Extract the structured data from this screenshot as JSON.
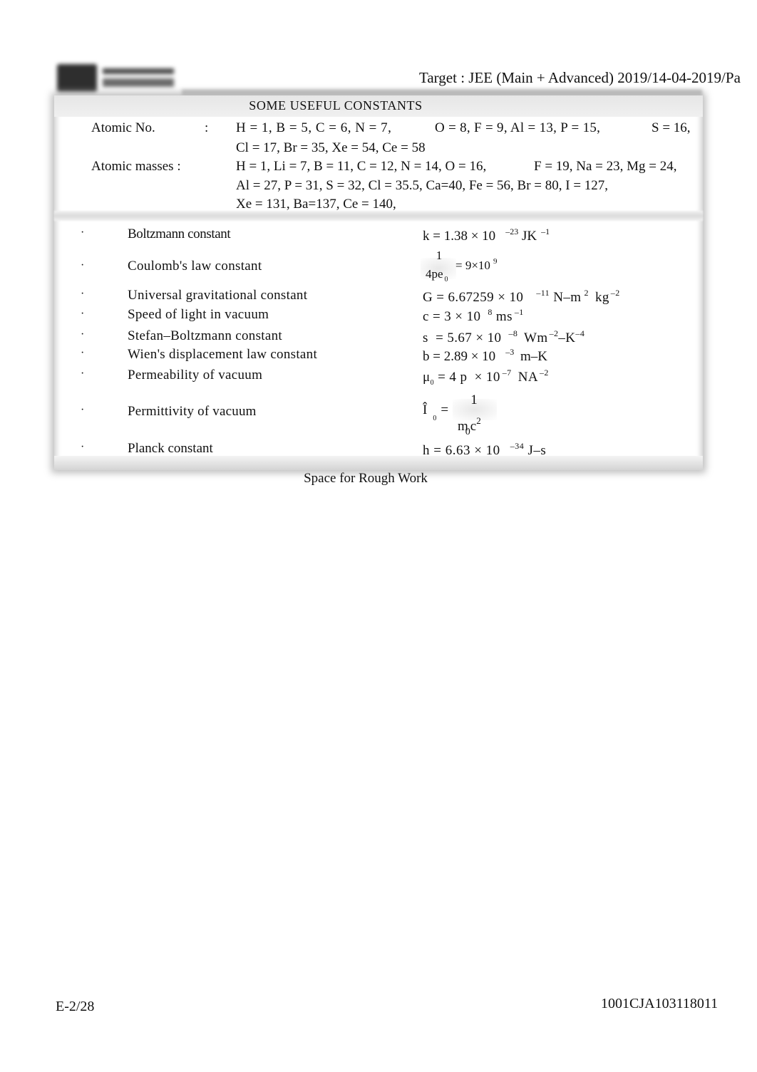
{
  "header": {
    "target": "Target : JEE (Main + Advanced) 2019/14-04-2019/Pa"
  },
  "box": {
    "title": "SOME USEFUL CONSTANTS",
    "atomic_no": {
      "label": "Atomic No.",
      "colon": ":",
      "line1_a": "H = 1, B = 5, C = 6, N = 7,",
      "line1_b": "O = 8, F = 9, Al = 13, P = 15,",
      "line1_c": "S = 16,",
      "line2": "Cl = 17, Br = 35, Xe = 54, Ce = 58"
    },
    "atomic_masses": {
      "label": "Atomic masses :",
      "line1_a": "H = 1, Li = 7, B = 11, C = 12, N = 14, O = 16,",
      "line1_b": "F = 19, Na = 23, Mg = 24,",
      "line2": "Al = 27, P = 31, S = 32, Cl = 35.5, Ca=40, Fe = 56, Br = 80, I = 127,",
      "line3": "Xe = 131, Ba=137, Ce = 140,"
    },
    "bullet": "·",
    "constants": [
      {
        "name": "Boltzmann constant",
        "v": "k = 1.38 × 10",
        "e1": "–23",
        "u": " JK",
        "e2": "–1"
      },
      {
        "name": "Coulomb's law constant",
        "num": "1",
        "den": "4pe",
        "den_sub": "0",
        "rhs": "= 9×10",
        "e1": "9"
      },
      {
        "name": "Universal gravitational constant",
        "v": "G = 6.67259 × 10",
        "e1": "–11",
        "u": " N–m",
        "e2": "2",
        "u2": " kg",
        "e3": "–2"
      },
      {
        "name": "Speed of light in vacuum",
        "v": "c = 3 × 10",
        "e1": "8",
        "u": " ms",
        "e2": "–1"
      },
      {
        "name": "Stefan–Boltzmann constant",
        "v": "s  = 5.67 × 10",
        "e1": "–8",
        "u": " Wm",
        "e2": "–2",
        "u2": "–K",
        "e3": "–4"
      },
      {
        "name": "Wien's displacement law constant",
        "v": "b = 2.89 × 10",
        "e1": "–3",
        "u": " m–K"
      },
      {
        "name": "Permeability of vacuum",
        "sym": "μ",
        "sym_sub": "0",
        "v": " = 4 p  × 10",
        "e1": "–7",
        "u": " NA",
        "e2": "–2"
      },
      {
        "name": "Permittivity of vacuum",
        "sym": "Î",
        "sym_sub": "0",
        "eq": "=",
        "num": "1",
        "den": "m",
        "den_sub": "0",
        "den2": "c",
        "den_sup": "2"
      },
      {
        "name": "Planck constant",
        "v": "h = 6.63 × 10",
        "e1": "–34",
        "u": " J–s"
      }
    ]
  },
  "rough_work": "Space for Rough Work",
  "footer": {
    "page": "E-2/28",
    "code": "1001CJA103118011"
  }
}
